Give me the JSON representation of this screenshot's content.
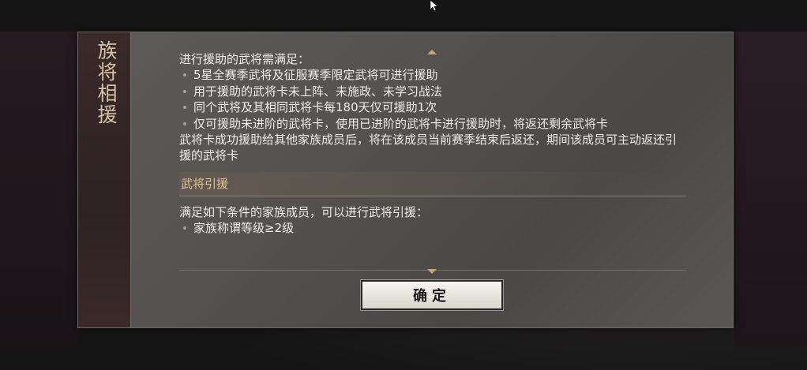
{
  "dialog": {
    "title": "族将相援",
    "intro": "进行援助的武将需满足：",
    "requirements": [
      "5星全赛季武将及征服赛季限定武将可进行援助",
      "用于援助的武将卡未上阵、未施政、未学习战法",
      "同个武将及其相同武将卡每180天仅可援助1次",
      "仅可援助未进阶的武将卡，使用已进阶的武将卡进行援助时，将返还剩余武将卡"
    ],
    "note": "武将卡成功援助给其他家族成员后，将在该成员当前赛季结束后返还，期间该成员可主动返还引援的武将卡",
    "section_title": "武将引援",
    "section_intro": "满足如下条件的家族成员，可以进行武将引援：",
    "section_items": [
      "家族称谓等级≥2级"
    ],
    "confirm_label": "确定"
  },
  "colors": {
    "accent": "#caa86a",
    "title_text": "#d7c3a3"
  },
  "icons": {
    "scroll_up": "chevron-up-icon",
    "scroll_down": "chevron-down-icon",
    "cursor": "mouse-cursor-icon"
  }
}
